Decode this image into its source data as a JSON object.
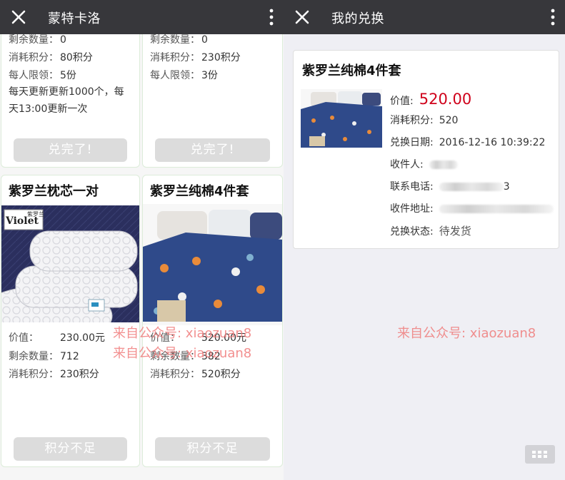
{
  "left": {
    "title": "蒙特卡洛",
    "top_cards": [
      {
        "rows": [
          {
            "label": "剩余数量：",
            "value": "0"
          },
          {
            "label": "消耗积分：",
            "value": "80积分"
          },
          {
            "label": "每人限领：",
            "value": "5份"
          }
        ],
        "note": "每天更新更新1000个，每天13:00更新一次",
        "button": "兑完了!"
      },
      {
        "rows": [
          {
            "label": "剩余数量：",
            "value": "0"
          },
          {
            "label": "消耗积分：",
            "value": "230积分"
          },
          {
            "label": "每人限领：",
            "value": "3份"
          }
        ],
        "button": "兑完了!"
      }
    ],
    "products": [
      {
        "name": "紫罗兰枕芯一对",
        "brand_logo": "Violet",
        "brand_cn": "紫罗兰",
        "rows": [
          {
            "label": "价值：",
            "value": "230.00元"
          },
          {
            "label": "剩余数量：",
            "value": "712"
          },
          {
            "label": "消耗积分：",
            "value": "230积分"
          }
        ],
        "button": "积分不足"
      },
      {
        "name": "紫罗兰纯棉4件套",
        "rows": [
          {
            "label": "价值：",
            "value": "520.00元"
          },
          {
            "label": "剩余数量：",
            "value": "382"
          },
          {
            "label": "消耗积分：",
            "value": "520积分"
          }
        ],
        "button": "积分不足"
      }
    ],
    "watermark": "来自公众号: xiaozuan8"
  },
  "right": {
    "title": "我的兑换",
    "order": {
      "name": "紫罗兰纯棉4件套",
      "price_label": "价值:",
      "price": "520.00",
      "points_label": "消耗积分:",
      "points": "520",
      "date_label": "兑换日期:",
      "date": "2016-12-16 10:39:22",
      "recipient_label": "收件人:",
      "phone_label": "联系电话:",
      "phone_tail": "3",
      "address_label": "收件地址:",
      "status_label": "兑换状态:",
      "status": "待发货"
    },
    "watermark": "来自公众号: xiaozuan8"
  },
  "colors": {
    "topbar": "#37373b",
    "price": "#d0021b",
    "watermark": "#f07c7c",
    "disabled_button": "#dcdcdc"
  }
}
